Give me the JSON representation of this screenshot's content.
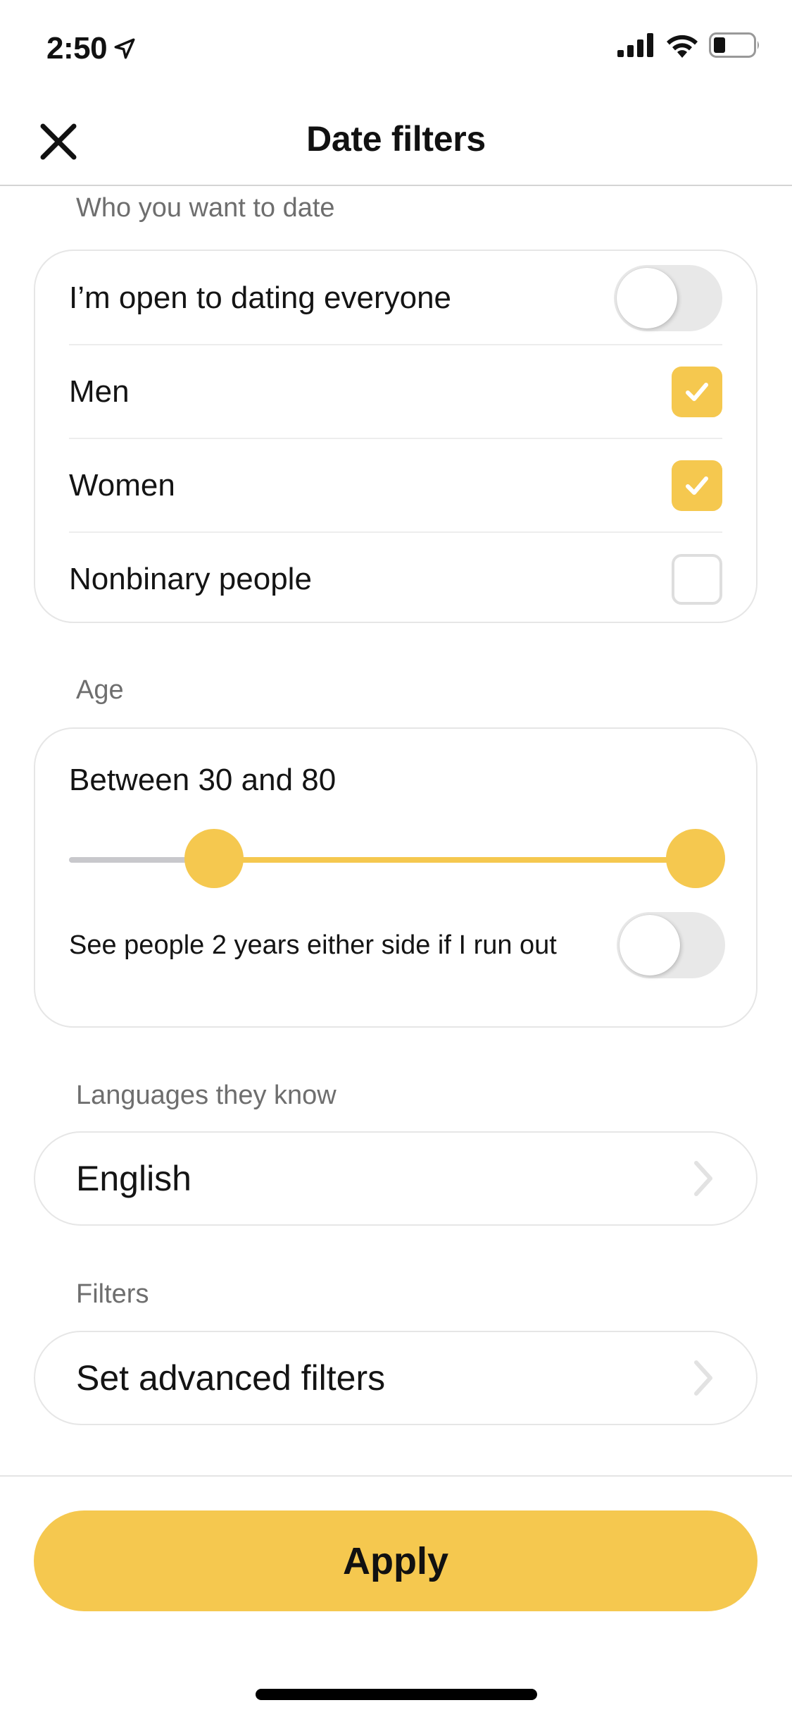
{
  "status_bar": {
    "time": "2:50",
    "icons": [
      "location-arrow-icon",
      "cellular-signal-icon",
      "wifi-icon",
      "battery-icon"
    ]
  },
  "header": {
    "title": "Date filters",
    "close_icon": "close-icon"
  },
  "who_section": {
    "label": "Who you want to date",
    "open_to_everyone": {
      "label": "I’m open to dating everyone",
      "on": false
    },
    "options": [
      {
        "label": "Men",
        "checked": true
      },
      {
        "label": "Women",
        "checked": true
      },
      {
        "label": "Nonbinary people",
        "checked": false
      }
    ]
  },
  "age_section": {
    "label": "Age",
    "summary": "Between 30 and 80",
    "range": {
      "min": 18,
      "max": 80,
      "low": 30,
      "high": 80
    },
    "expand": {
      "label": "See people 2 years either side if I run out",
      "on": false
    }
  },
  "languages_section": {
    "label": "Languages they know",
    "value": "English"
  },
  "filters_section": {
    "label": "Filters",
    "value": "Set advanced filters"
  },
  "footer": {
    "apply_label": "Apply"
  },
  "colors": {
    "accent": "#f5c84f",
    "toggle_off": "#e8e8e8",
    "section_label": "#6e6e6e",
    "border": "#e6e6e6"
  }
}
